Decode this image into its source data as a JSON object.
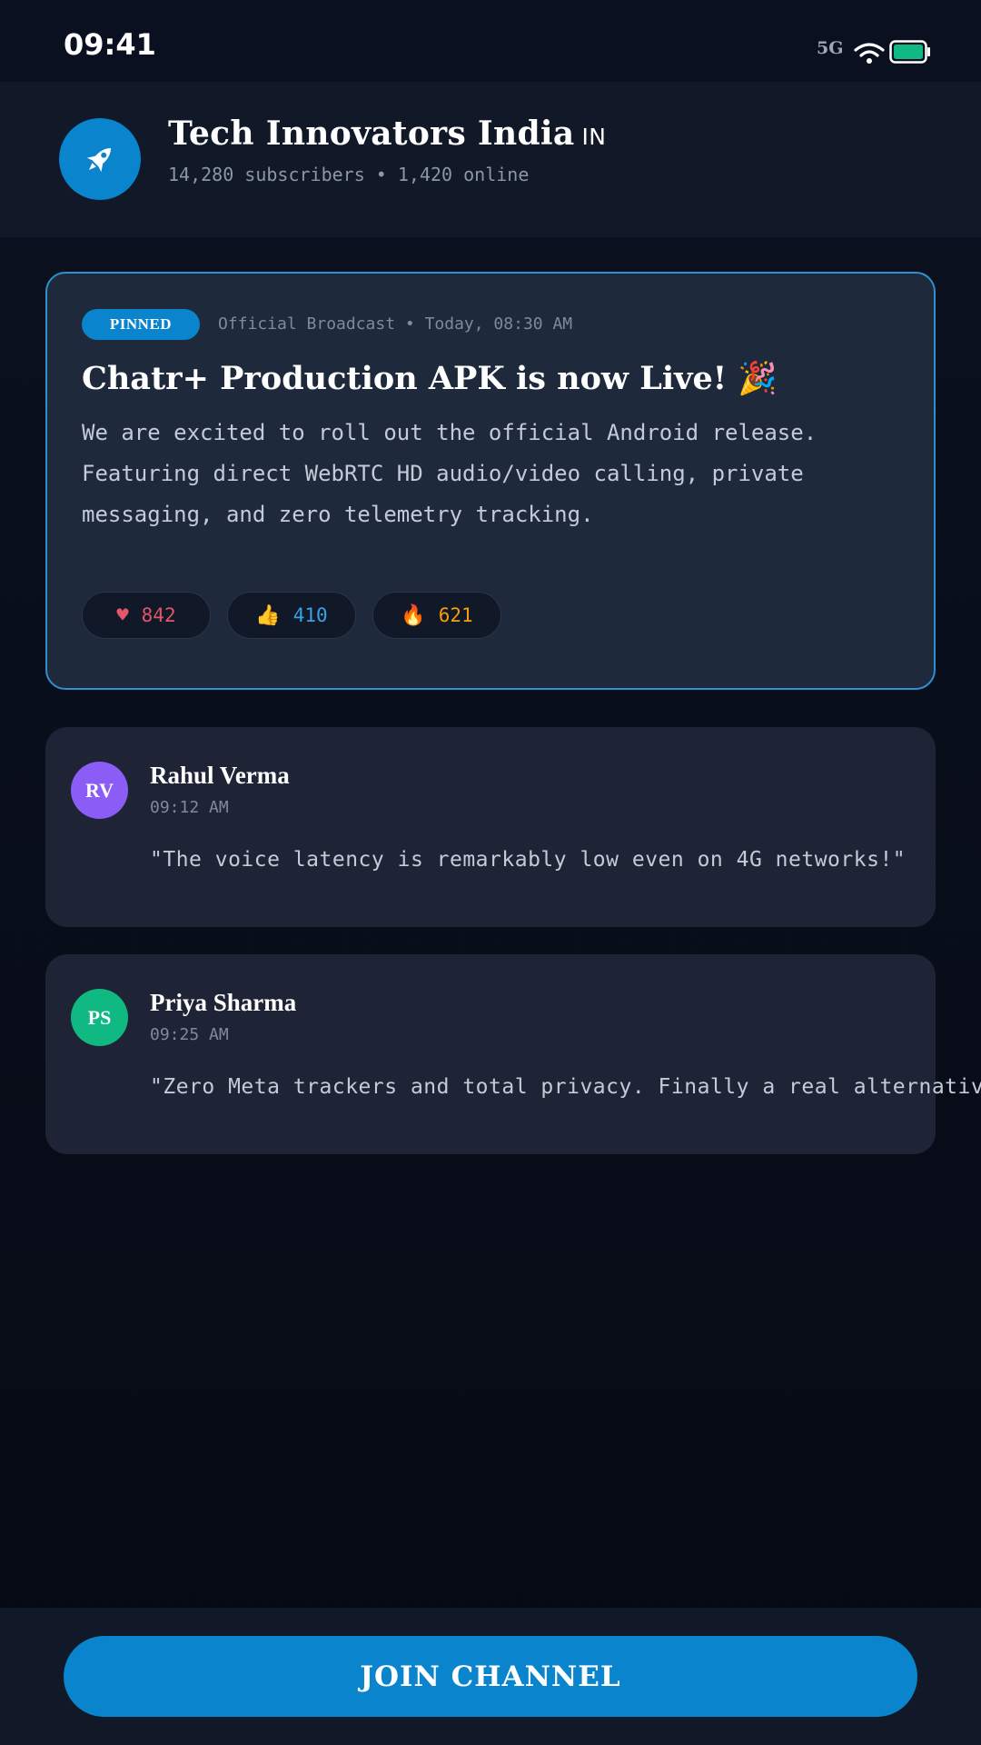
{
  "status_bar": {
    "time": "09:41",
    "network": "5G",
    "icons": [
      "wifi-icon",
      "battery-icon"
    ]
  },
  "channel": {
    "name": "Tech Innovators India",
    "country": "IN",
    "stats": "14,280 subscribers • 1,420 online",
    "avatar_icon": "rocket-icon"
  },
  "pinned_post": {
    "badge": "PINNED",
    "meta": "Official Broadcast • Today, 08:30 AM",
    "title": "Chatr+ Production APK is now Live! 🎉",
    "body": "We are excited to roll out the official Android release. Featuring direct WebRTC HD audio/video calling, private messaging, and zero telemetry tracking.",
    "reactions": [
      {
        "icon": "heart-icon",
        "count": "842",
        "color": "#e0566b"
      },
      {
        "icon": "thumbs-up-icon",
        "count": "410",
        "color": "#38a3e6"
      },
      {
        "icon": "fire-icon",
        "count": "621",
        "color": "#f59e0b"
      }
    ]
  },
  "comments": [
    {
      "initials": "RV",
      "name": "Rahul Verma",
      "time": "09:12 AM",
      "text": "\"The voice latency is remarkably low even on 4G networks!\"",
      "avatar_color": "#8b5cf6"
    },
    {
      "initials": "PS",
      "name": "Priya Sharma",
      "time": "09:25 AM",
      "text": "\"Zero Meta trackers and total privacy. Finally a real alternative.\"",
      "avatar_color": "#10b981"
    }
  ],
  "footer": {
    "join_label": "JOIN CHANNEL"
  },
  "colors": {
    "accent": "#0a84cc",
    "card": "#1e293b",
    "background": "#0b1120"
  }
}
